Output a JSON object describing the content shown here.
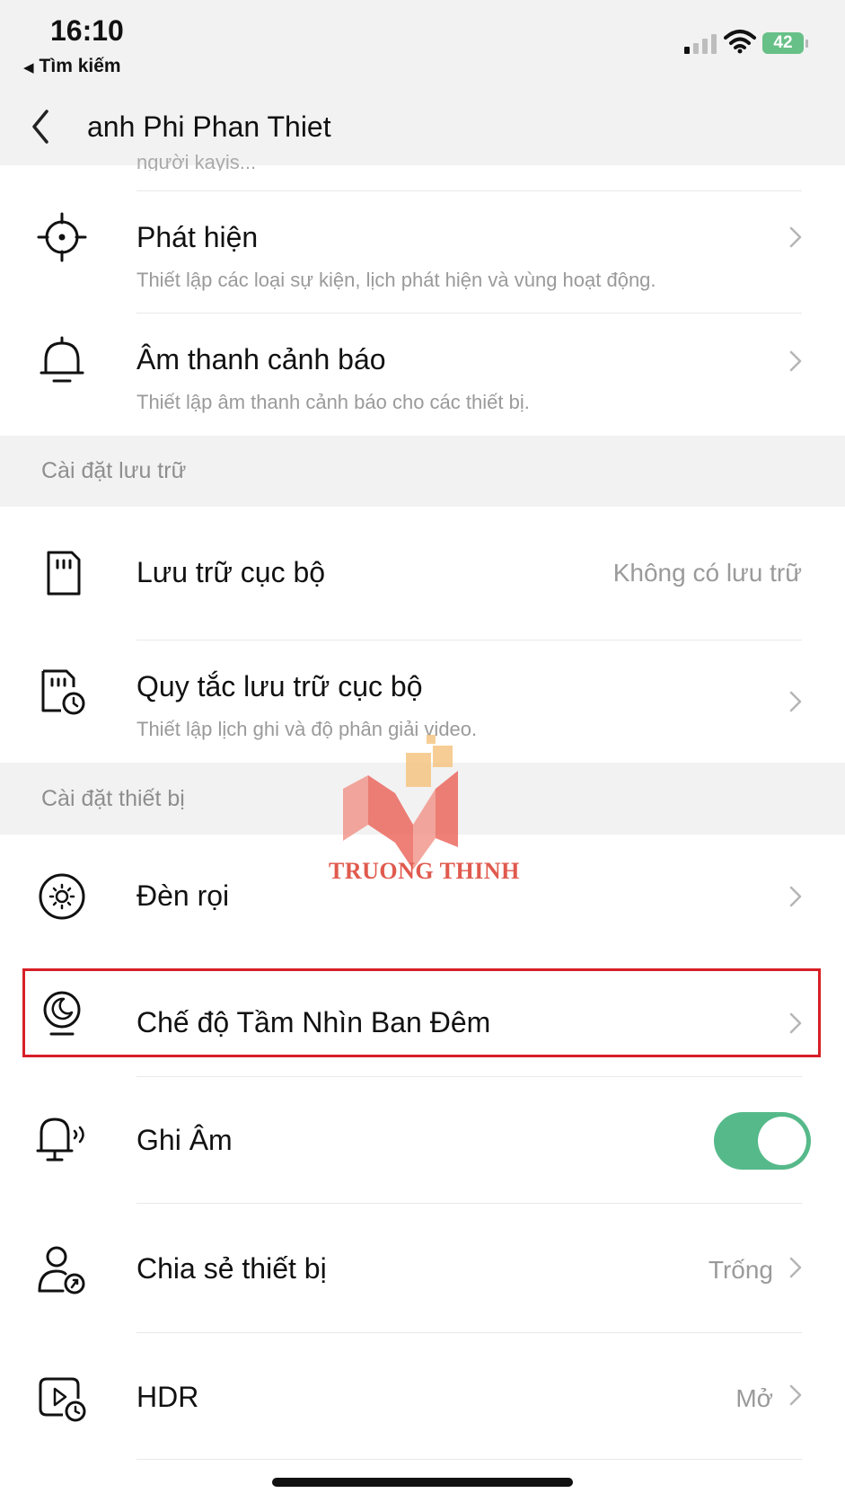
{
  "status_bar": {
    "time": "16:10",
    "back_app": "Tìm kiếm",
    "battery": "42"
  },
  "nav": {
    "title": "anh Phi Phan Thiet"
  },
  "cut_text": "người kayis...",
  "rows": {
    "detection": {
      "title": "Phát hiện",
      "subtitle": "Thiết lập các loại sự kiện, lịch phát hiện và vùng hoạt động."
    },
    "alert_sound": {
      "title": "Âm thanh cảnh báo",
      "subtitle": "Thiết lập âm thanh cảnh báo cho các thiết bị."
    },
    "local_storage": {
      "title": "Lưu trữ cục bộ",
      "value": "Không có lưu trữ"
    },
    "storage_rules": {
      "title": "Quy tắc lưu trữ cục bộ",
      "subtitle": "Thiết lập lịch ghi và độ phân giải video."
    },
    "spotlight": {
      "title": "Đèn rọi"
    },
    "night_vision": {
      "title": "Chế độ Tầm Nhìn Ban Đêm"
    },
    "audio_recording": {
      "title": "Ghi Âm",
      "enabled": true
    },
    "device_sharing": {
      "title": "Chia sẻ thiết bị",
      "value": "Trống"
    },
    "hdr": {
      "title": "HDR",
      "value": "Mở"
    }
  },
  "sections": {
    "storage": "Cài đặt lưu trữ",
    "device": "Cài đặt thiết bị"
  },
  "watermark": "TRUONG THINH",
  "colors": {
    "toggle_on": "#56b98a",
    "highlight_border": "#d81f26",
    "section_bg": "#f2f2f2",
    "battery": "#67c087"
  },
  "icons": {
    "detection": "crosshair-icon",
    "alert_sound": "bell-icon",
    "local_storage": "sd-card-icon",
    "storage_rules": "sd-card-clock-icon",
    "spotlight": "sun-icon",
    "night_vision": "moon-bulb-icon",
    "audio_recording": "microphone-sound-icon",
    "device_sharing": "user-share-icon",
    "hdr": "video-play-icon"
  }
}
